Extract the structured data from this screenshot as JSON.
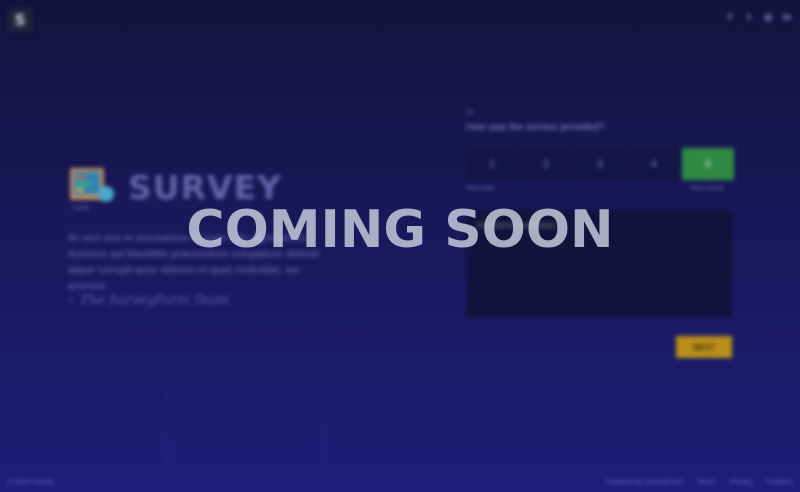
{
  "header": {
    "logo_letter": "S",
    "social": [
      {
        "icon": "facebook-icon",
        "glyph": "f"
      },
      {
        "icon": "twitter-icon",
        "glyph": "t"
      },
      {
        "icon": "instagram-icon",
        "glyph": "◎"
      },
      {
        "icon": "linkedin-icon",
        "glyph": "in"
      }
    ]
  },
  "brand": {
    "name": "SURVEY",
    "subtitle": "FORM",
    "intro": "At vero eos et accusamus et iusto odio dignissimos ducimus qui blanditiis praesentium voluptatum deleniti atque corrupti quos dolores et quas molestias, we promise.",
    "signature": "The SurveyForm Team"
  },
  "question": {
    "label": "Q1",
    "text": "How was the service provided?",
    "options": [
      "1",
      "2",
      "3",
      "4",
      "5"
    ],
    "selected_index": 4,
    "scale_low": "Very bad",
    "scale_high": "Very Good"
  },
  "feedback": {
    "placeholder": "Additional feedback..."
  },
  "actions": {
    "next_label": "NEXT"
  },
  "footer": {
    "copyright": "© 2022 Survey",
    "links": [
      "Powered by SurveyForm",
      "Terms",
      "Privacy",
      "Cookies"
    ]
  },
  "overlay": {
    "text": "COMING SOON"
  },
  "colors": {
    "accent_green": "#2f8b43",
    "accent_gold": "#b98f1a",
    "background": "#19185a"
  }
}
